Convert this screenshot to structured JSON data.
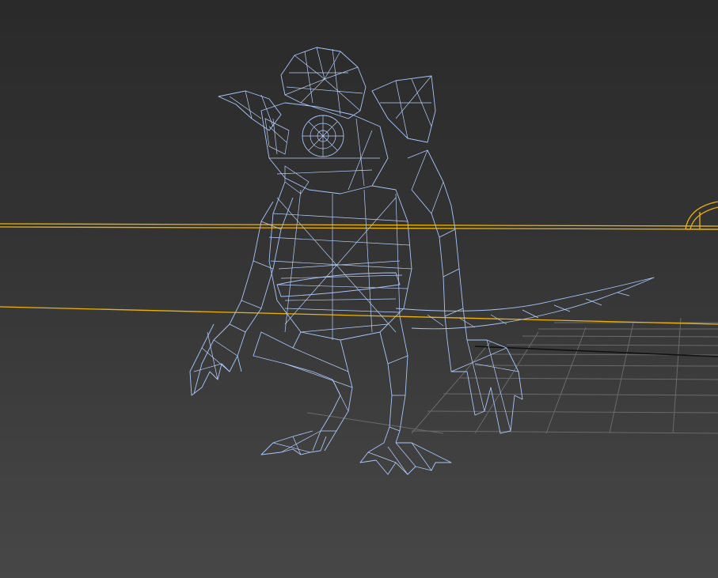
{
  "viewport": {
    "colors": {
      "background_top": "#2a2a2a",
      "background_bottom": "#474747",
      "wireframe": "#a9c4f7",
      "grid": "#6a6a6a",
      "selection_gizmo": "#f0b400",
      "axis_line": "#111111"
    },
    "display_mode": "wireframe",
    "model": "creature"
  }
}
